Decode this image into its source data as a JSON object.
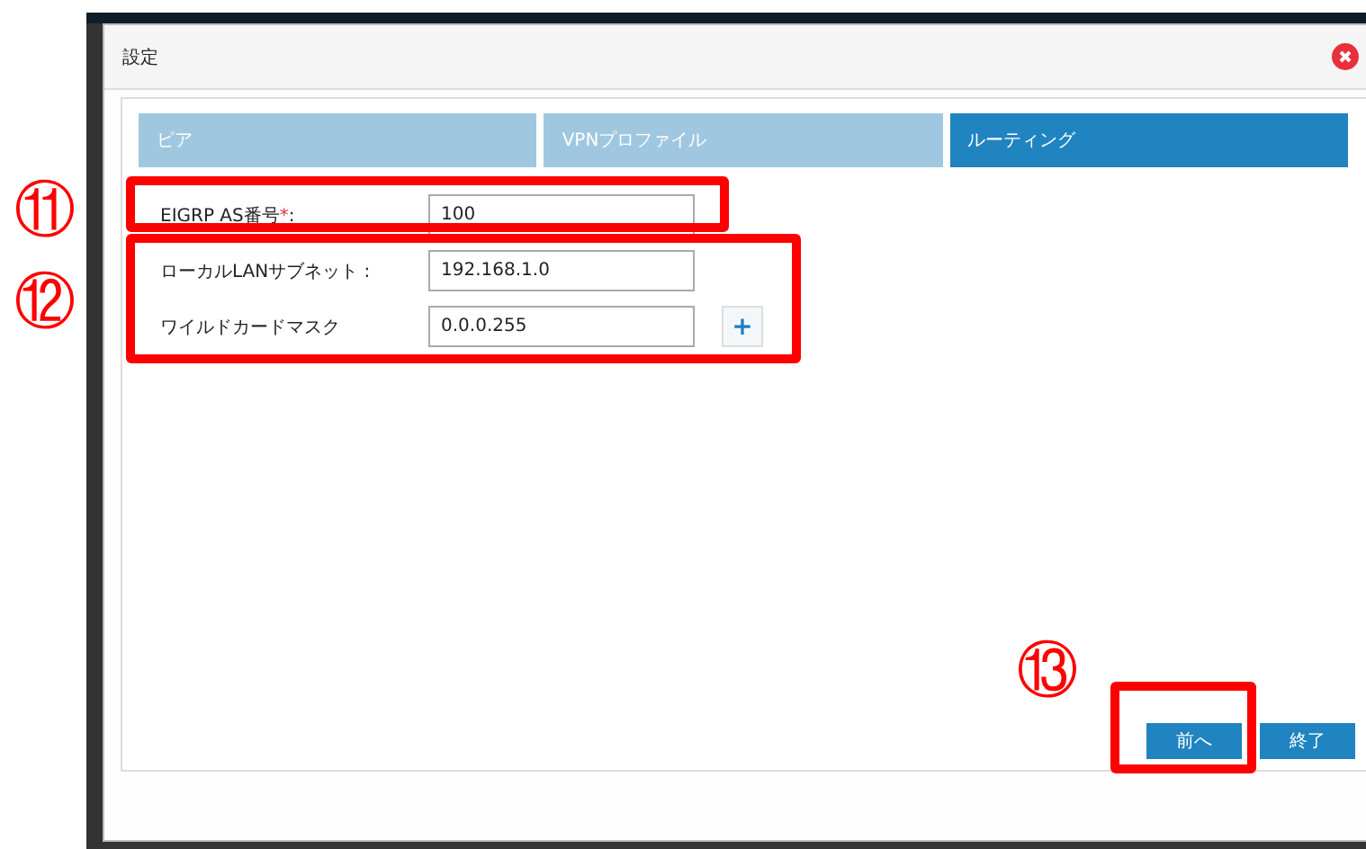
{
  "dialog": {
    "title": "設定"
  },
  "tabs": [
    {
      "label": "ピア",
      "selected": false
    },
    {
      "label": "VPNプロファイル",
      "selected": false
    },
    {
      "label": "ルーティング",
      "selected": true
    }
  ],
  "fields": [
    {
      "label": "EIGRP AS番号",
      "required_mark": "*",
      "suffix": ":",
      "value": "100"
    },
    {
      "label": "ローカルLANサブネット :",
      "value": "192.168.1.0"
    },
    {
      "label": "ワイルドカードマスク",
      "value": "0.0.0.255",
      "add_label": "+"
    }
  ],
  "buttons": [
    {
      "label": "前へ"
    },
    {
      "label": "終了"
    }
  ],
  "annotations": [
    {
      "label": "⑪"
    },
    {
      "label": "⑫"
    },
    {
      "label": "⑬"
    }
  ]
}
